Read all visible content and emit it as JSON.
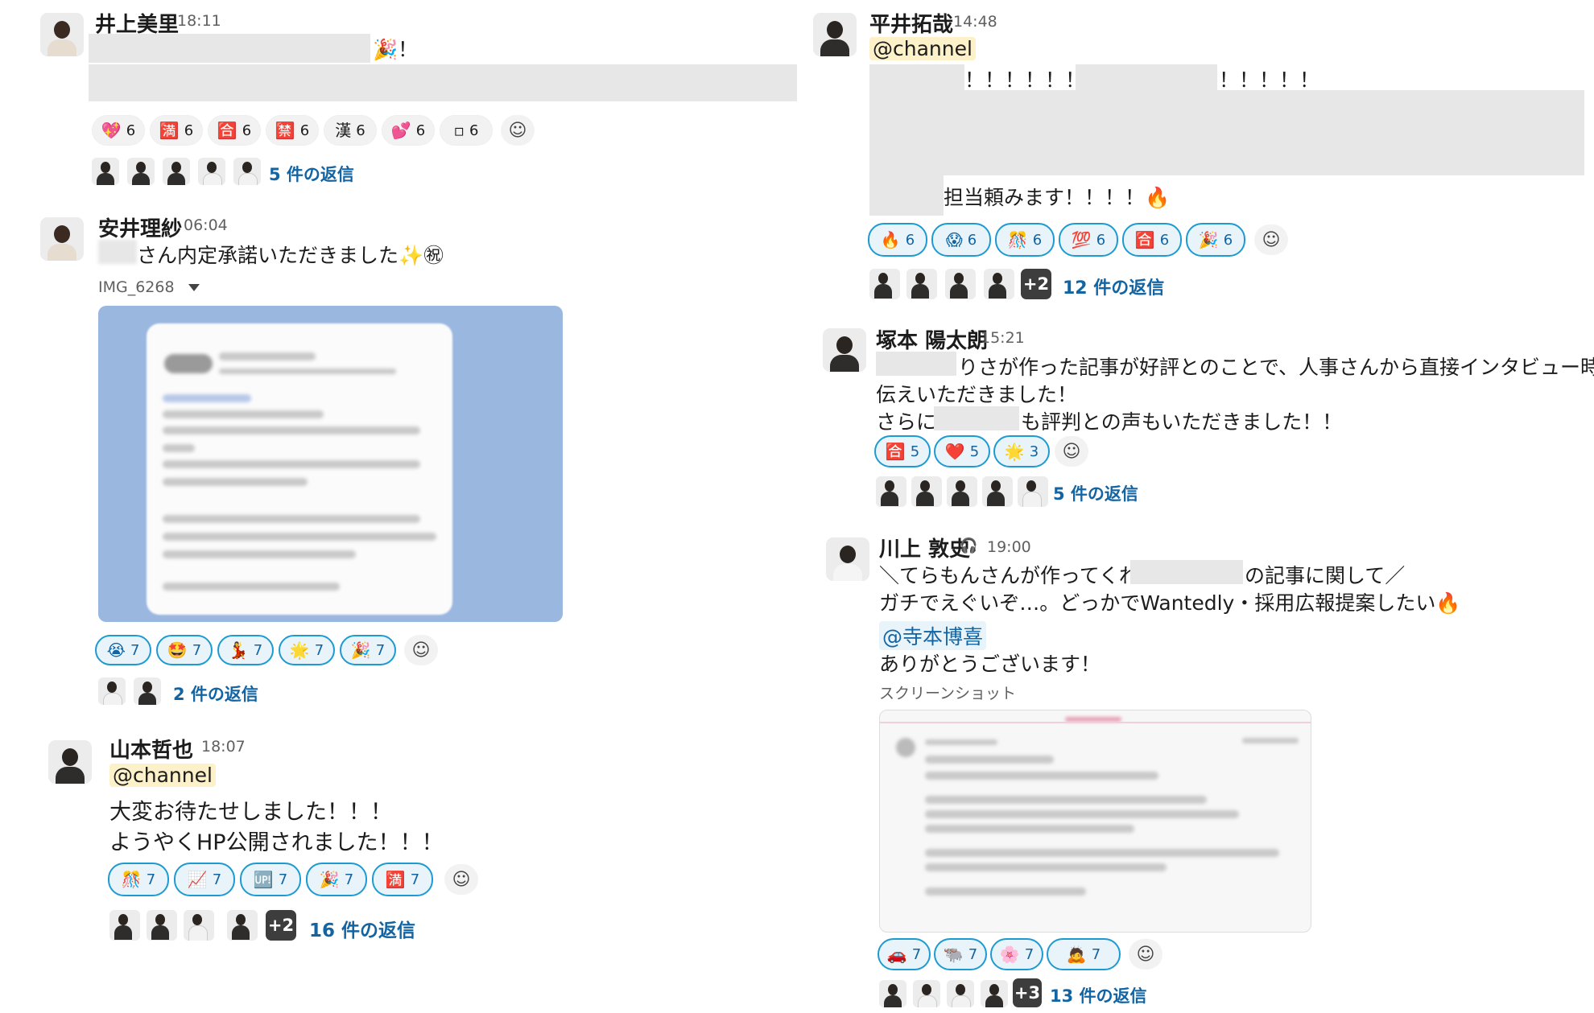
{
  "messages": [
    {
      "author": "井上美里",
      "time": "18:11",
      "text_suffix": "🎉！",
      "reactions": [
        {
          "emoji": "💖",
          "count": "6"
        },
        {
          "emoji": "🈵",
          "count": "6"
        },
        {
          "emoji": "🈴",
          "count": "6"
        },
        {
          "emoji": "🈲",
          "count": "6"
        },
        {
          "emoji": "漢",
          "count": "6"
        },
        {
          "emoji": "💕",
          "count": "6"
        },
        {
          "emoji": "▫",
          "count": "6"
        }
      ],
      "replies": "5 件の返信"
    },
    {
      "author": "安井理紗",
      "time": "06:04",
      "text": "さん内定承諾いただきました✨㊗",
      "attachment_name": "IMG_6268",
      "reactions": [
        {
          "emoji": "😭",
          "count": "7"
        },
        {
          "emoji": "🤩",
          "count": "7"
        },
        {
          "emoji": "💃",
          "count": "7"
        },
        {
          "emoji": "🌟",
          "count": "7"
        },
        {
          "emoji": "🎉",
          "count": "7"
        }
      ],
      "replies": "2 件の返信"
    },
    {
      "author": "山本哲也",
      "time": "18:07",
      "mention": "@channel",
      "lines": [
        "大変お待たせしました！！！",
        "ようやくHP公開されました！！！"
      ],
      "reactions": [
        {
          "emoji": "🎊",
          "count": "7"
        },
        {
          "emoji": "📈",
          "count": "7"
        },
        {
          "emoji": "🆙",
          "count": "7"
        },
        {
          "emoji": "🎉",
          "count": "7"
        },
        {
          "emoji": "🈵",
          "count": "7"
        }
      ],
      "more_users": "+2",
      "replies": "16 件の返信"
    },
    {
      "author": "平井拓哉",
      "time": "14:48",
      "mention": "@channel",
      "exclaim_a": "！！！！！！",
      "exclaim_b": "！！！！！",
      "line_end": "担当頼みます！！！！🔥",
      "reactions": [
        {
          "emoji": "🔥",
          "count": "6"
        },
        {
          "emoji": "😱",
          "count": "6"
        },
        {
          "emoji": "🎊",
          "count": "6"
        },
        {
          "emoji": "💯",
          "count": "6"
        },
        {
          "emoji": "🈴",
          "count": "6"
        },
        {
          "emoji": "🎉",
          "count": "6"
        }
      ],
      "more_users": "+2",
      "replies": "12 件の返信"
    },
    {
      "author": "塚本 陽太朗",
      "time": "15:21",
      "line1": "りさが作った記事が好評とのことで、人事さんから直接インタビュー時にお",
      "line2": "伝えいただきました！",
      "line3a": "さらに",
      "line3b": "も評判との声もいただきました！！",
      "reactions": [
        {
          "emoji": "🈴",
          "count": "5"
        },
        {
          "emoji": "❤️",
          "count": "5"
        },
        {
          "emoji": "🌟",
          "count": "3"
        }
      ],
      "replies": "5 件の返信"
    },
    {
      "author": "川上 敦史",
      "time": "19:00",
      "line1a": "＼てらもんさんが作ってくれた",
      "line1b": "の記事に関して／",
      "line2": "ガチでえぐいぞ…。どっかでWantedly・採用広報提案したい🔥",
      "mention": "@寺本博喜",
      "line3": "ありがとうございます！",
      "attachment_name": "スクリーンショット",
      "reactions": [
        {
          "emoji": "🚗",
          "count": "7"
        },
        {
          "emoji": "🐃",
          "count": "7"
        },
        {
          "emoji": "🌸",
          "count": "7"
        },
        {
          "emoji": "🙇",
          "count": "7"
        }
      ],
      "more_users": "+3",
      "replies": "13 件の返信"
    }
  ],
  "icons": {
    "add_reaction": "add-reaction-icon",
    "headset": "headset-icon"
  }
}
